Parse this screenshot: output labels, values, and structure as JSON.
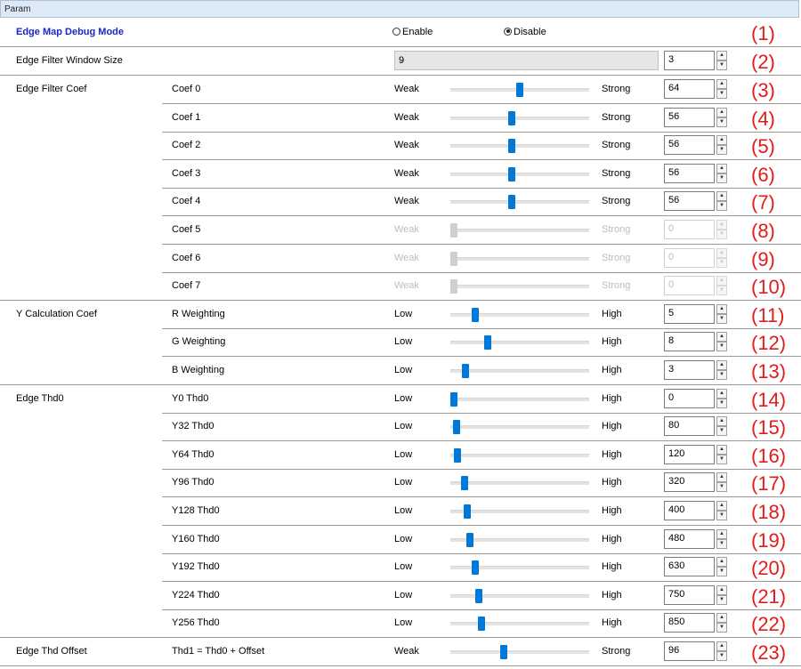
{
  "panel_title": "Param",
  "row1": {
    "label": "Edge Map Debug Mode",
    "enable_label": "Enable",
    "disable_label": "Disable",
    "selected": "Disable",
    "index": "(1)"
  },
  "row2": {
    "label": "Edge Filter Window Size",
    "combo_value": "9",
    "spin_value": "3",
    "index": "(2)"
  },
  "sliders": [
    {
      "group": "Edge Filter Coef",
      "sub": "Coef 0",
      "low": "Weak",
      "high": "Strong",
      "value": "64",
      "level": 0.5,
      "enabled": true,
      "index": "(3)"
    },
    {
      "group": "",
      "sub": "Coef 1",
      "low": "Weak",
      "high": "Strong",
      "value": "56",
      "level": 0.44,
      "enabled": true,
      "index": "(4)"
    },
    {
      "group": "",
      "sub": "Coef 2",
      "low": "Weak",
      "high": "Strong",
      "value": "56",
      "level": 0.44,
      "enabled": true,
      "index": "(5)"
    },
    {
      "group": "",
      "sub": "Coef 3",
      "low": "Weak",
      "high": "Strong",
      "value": "56",
      "level": 0.44,
      "enabled": true,
      "index": "(6)"
    },
    {
      "group": "",
      "sub": "Coef 4",
      "low": "Weak",
      "high": "Strong",
      "value": "56",
      "level": 0.44,
      "enabled": true,
      "index": "(7)"
    },
    {
      "group": "",
      "sub": "Coef 5",
      "low": "Weak",
      "high": "Strong",
      "value": "0",
      "level": 0,
      "enabled": false,
      "index": "(8)"
    },
    {
      "group": "",
      "sub": "Coef 6",
      "low": "Weak",
      "high": "Strong",
      "value": "0",
      "level": 0,
      "enabled": false,
      "index": "(9)"
    },
    {
      "group": "",
      "sub": "Coef 7",
      "low": "Weak",
      "high": "Strong",
      "value": "0",
      "level": 0,
      "enabled": false,
      "index": "(10)"
    },
    {
      "group": "Y Calculation Coef",
      "sub": "R Weighting",
      "low": "Low",
      "high": "High",
      "value": "5",
      "level": 0.16,
      "enabled": true,
      "index": "(11)"
    },
    {
      "group": "",
      "sub": "G Weighting",
      "low": "Low",
      "high": "High",
      "value": "8",
      "level": 0.26,
      "enabled": true,
      "index": "(12)"
    },
    {
      "group": "",
      "sub": "B Weighting",
      "low": "Low",
      "high": "High",
      "value": "3",
      "level": 0.09,
      "enabled": true,
      "index": "(13)"
    },
    {
      "group": "Edge Thd0",
      "sub": "Y0 Thd0",
      "low": "Low",
      "high": "High",
      "value": "0",
      "level": 0,
      "enabled": true,
      "index": "(14)"
    },
    {
      "group": "",
      "sub": "Y32 Thd0",
      "low": "Low",
      "high": "High",
      "value": "80",
      "level": 0.02,
      "enabled": true,
      "index": "(15)"
    },
    {
      "group": "",
      "sub": "Y64 Thd0",
      "low": "Low",
      "high": "High",
      "value": "120",
      "level": 0.03,
      "enabled": true,
      "index": "(16)"
    },
    {
      "group": "",
      "sub": "Y96 Thd0",
      "low": "Low",
      "high": "High",
      "value": "320",
      "level": 0.08,
      "enabled": true,
      "index": "(17)"
    },
    {
      "group": "",
      "sub": "Y128 Thd0",
      "low": "Low",
      "high": "High",
      "value": "400",
      "level": 0.1,
      "enabled": true,
      "index": "(18)"
    },
    {
      "group": "",
      "sub": "Y160 Thd0",
      "low": "Low",
      "high": "High",
      "value": "480",
      "level": 0.12,
      "enabled": true,
      "index": "(19)"
    },
    {
      "group": "",
      "sub": "Y192 Thd0",
      "low": "Low",
      "high": "High",
      "value": "630",
      "level": 0.16,
      "enabled": true,
      "index": "(20)"
    },
    {
      "group": "",
      "sub": "Y224 Thd0",
      "low": "Low",
      "high": "High",
      "value": "750",
      "level": 0.19,
      "enabled": true,
      "index": "(21)"
    },
    {
      "group": "",
      "sub": "Y256 Thd0",
      "low": "Low",
      "high": "High",
      "value": "850",
      "level": 0.21,
      "enabled": true,
      "index": "(22)"
    },
    {
      "group": "Edge Thd Offset",
      "sub": "Thd1 = Thd0 + Offset",
      "low": "Weak",
      "high": "Strong",
      "value": "96",
      "level": 0.38,
      "enabled": true,
      "index": "(23)"
    }
  ],
  "colors": {
    "accent": "#0078d7",
    "index_red": "#e21b1b",
    "title_blue": "#1b25c9"
  }
}
